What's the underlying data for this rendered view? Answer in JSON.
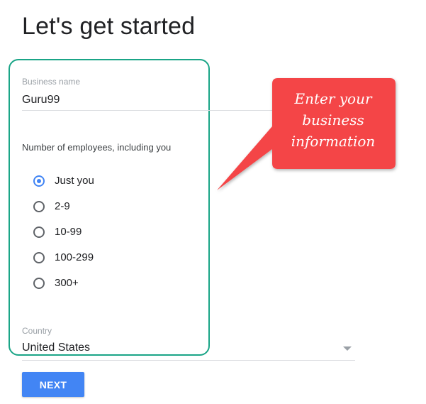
{
  "page": {
    "title": "Let's get started"
  },
  "business_name": {
    "label": "Business name",
    "value": "Guru99"
  },
  "employees": {
    "question": "Number of employees, including you",
    "options": [
      "Just you",
      "2-9",
      "10-99",
      "100-299",
      "300+"
    ],
    "selected": "Just you"
  },
  "country": {
    "label": "Country",
    "value": "United States"
  },
  "actions": {
    "next_label": "NEXT"
  },
  "callout": {
    "lines": [
      "Enter your",
      "business",
      "information"
    ]
  },
  "colors": {
    "highlight_border": "#1aa587",
    "callout_fill": "#f44446",
    "accent": "#4285f4"
  }
}
